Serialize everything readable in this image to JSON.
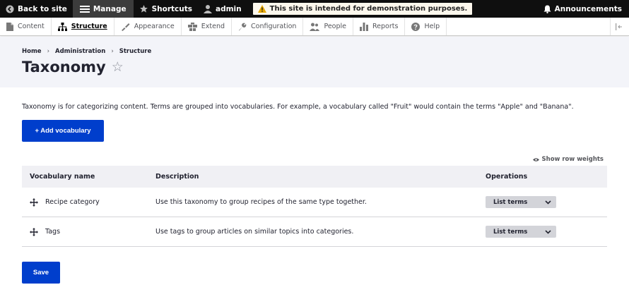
{
  "toolbar": {
    "back_label": "Back to site",
    "manage_label": "Manage",
    "shortcuts_label": "Shortcuts",
    "user_label": "admin",
    "warning_text": "This site is intended for demonstration purposes.",
    "announcements_label": "Announcements"
  },
  "tray": {
    "items": [
      {
        "label": "Content",
        "icon": "content-icon"
      },
      {
        "label": "Structure",
        "icon": "structure-icon"
      },
      {
        "label": "Appearance",
        "icon": "appearance-icon"
      },
      {
        "label": "Extend",
        "icon": "extend-icon"
      },
      {
        "label": "Configuration",
        "icon": "wrench-icon"
      },
      {
        "label": "People",
        "icon": "people-icon"
      },
      {
        "label": "Reports",
        "icon": "reports-icon"
      },
      {
        "label": "Help",
        "icon": "help-icon"
      }
    ],
    "active": "Structure"
  },
  "breadcrumb": [
    "Home",
    "Administration",
    "Structure"
  ],
  "page_title": "Taxonomy",
  "intro_text": "Taxonomy is for categorizing content. Terms are grouped into vocabularies. For example, a vocabulary called \"Fruit\" would contain the terms \"Apple\" and \"Banana\".",
  "add_button_label": "+ Add vocabulary",
  "row_weights_label": "Show row weights",
  "table": {
    "headers": {
      "name": "Vocabulary name",
      "description": "Description",
      "operations": "Operations"
    },
    "rows": [
      {
        "name": "Recipe category",
        "description": "Use this taxonomy to group recipes of the same type together.",
        "operation": "List terms"
      },
      {
        "name": "Tags",
        "description": "Use tags to group articles on similar topics into categories.",
        "operation": "List terms"
      }
    ]
  },
  "save_label": "Save",
  "colors": {
    "toolbar_bg": "#0f0f0f",
    "primary": "#003ecc",
    "header_bg": "#f3f4f9",
    "warning_bg": "#fdf8ed",
    "warning_icon": "#e6a700"
  }
}
